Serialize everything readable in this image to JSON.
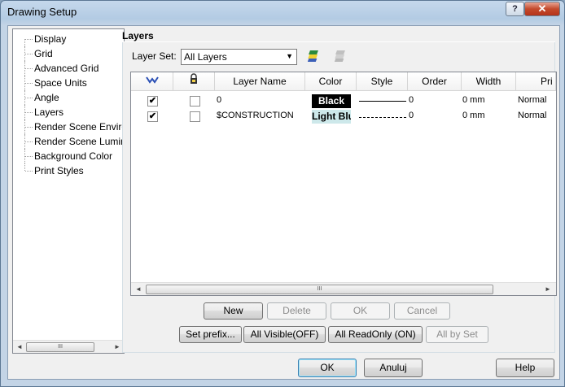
{
  "window": {
    "title": "Drawing Setup",
    "help_glyph": "?",
    "close_glyph": "✕"
  },
  "tree": {
    "items": [
      {
        "label": "Display"
      },
      {
        "label": "Grid"
      },
      {
        "label": "Advanced Grid"
      },
      {
        "label": "Space Units"
      },
      {
        "label": "Angle"
      },
      {
        "label": "Layers"
      },
      {
        "label": "Render Scene Environment"
      },
      {
        "label": "Render Scene Luminance"
      },
      {
        "label": "Background Color"
      },
      {
        "label": "Print Styles"
      }
    ]
  },
  "panel": {
    "title": "Layers",
    "layer_set_label": "Layer Set:",
    "layer_set_value": "All Layers",
    "icons": [
      "layer-set-manage-icon",
      "layer-set-disabled-icon"
    ]
  },
  "grid": {
    "headers": {
      "visible_icon": "visibility-icon",
      "lock_icon": "lock-icon",
      "name": "Layer Name",
      "color": "Color",
      "style": "Style",
      "order": "Order",
      "width": "Width",
      "print": "Pri"
    },
    "rows": [
      {
        "visible": "✔",
        "locked": "",
        "name": "0",
        "color_label": "Black",
        "color_bg": "#000000",
        "color_fg": "#ffffff",
        "order": "0",
        "width": "0 mm",
        "print": "Normal"
      },
      {
        "visible": "✔",
        "locked": "",
        "name": "$CONSTRUCTION",
        "color_label": "Light Blue",
        "color_bg": "#cde8ea",
        "color_fg": "#000000",
        "order": "0",
        "width": "0 mm",
        "print": "Normal"
      }
    ]
  },
  "buttons": {
    "new": "New",
    "delete": "Delete",
    "ok_small": "OK",
    "cancel": "Cancel",
    "set_prefix": "Set prefix...",
    "all_visible": "All Visible(OFF)",
    "all_readonly": "All ReadOnly (ON)",
    "all_by_set": "All by Set",
    "ok": "OK",
    "anuluj": "Anuluj",
    "help": "Help"
  },
  "scroll": {
    "left_glyph": "◄",
    "right_glyph": "►",
    "grip": "III"
  }
}
